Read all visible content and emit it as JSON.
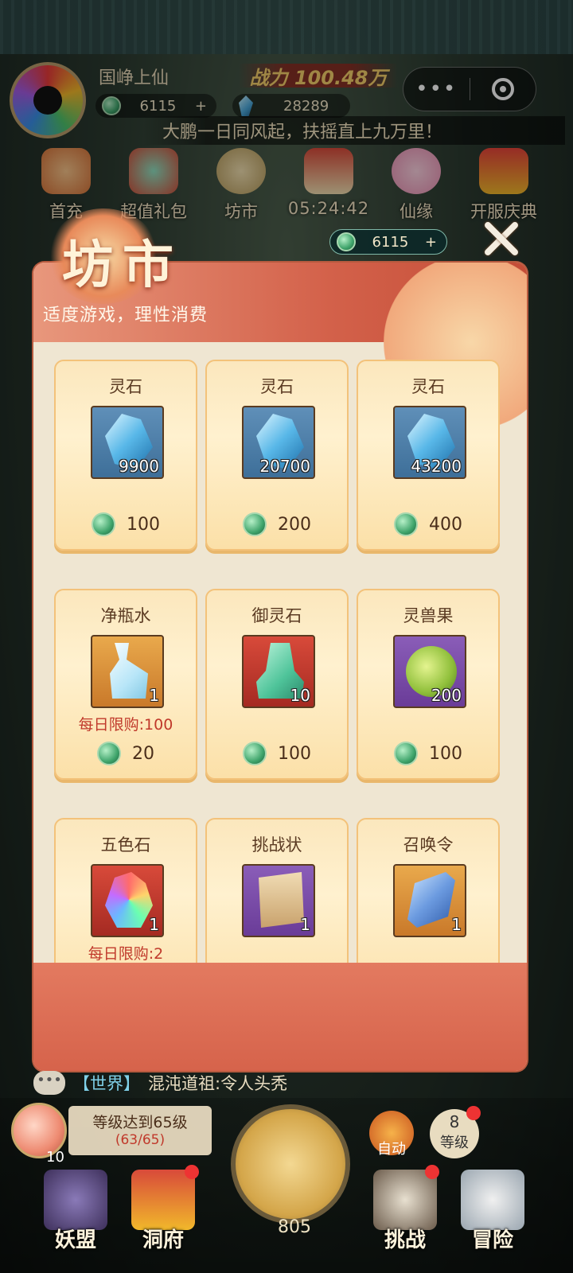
{
  "header": {
    "player_name": "国峥上仙",
    "coins": "6115",
    "coins_add": "+",
    "gems": "28289",
    "power": "战力 100.48万",
    "marquee": "大鹏一日同风起，扶摇直上九万里！"
  },
  "menu": [
    {
      "label": "首充",
      "icon": "gift-bag-icon"
    },
    {
      "label": "超值礼包",
      "icon": "treasure-bag-icon"
    },
    {
      "label": "坊市",
      "icon": "coin-icon"
    },
    {
      "label": "05:24:42",
      "icon": "shop-stall-icon"
    },
    {
      "label": "仙缘",
      "icon": "lotus-icon"
    },
    {
      "label": "开服庆典",
      "icon": "gift-box-icon"
    }
  ],
  "dialog": {
    "title": "坊市",
    "notice": "适度游戏，理性消费",
    "currency": "6115",
    "currency_add": "+"
  },
  "items": [
    {
      "name": "灵石",
      "qty": "9900",
      "price": "100",
      "limit": "",
      "bg": "blue",
      "art": "crystal"
    },
    {
      "name": "灵石",
      "qty": "20700",
      "price": "200",
      "limit": "",
      "bg": "blue",
      "art": "crystal"
    },
    {
      "name": "灵石",
      "qty": "43200",
      "price": "400",
      "limit": "",
      "bg": "blue",
      "art": "crystal"
    },
    {
      "name": "净瓶水",
      "qty": "1",
      "price": "20",
      "limit": "每日限购:100",
      "bg": "gold",
      "art": "vase"
    },
    {
      "name": "御灵石",
      "qty": "10",
      "price": "100",
      "limit": "",
      "bg": "red",
      "art": "jade"
    },
    {
      "name": "灵兽果",
      "qty": "200",
      "price": "100",
      "limit": "",
      "bg": "purple",
      "art": "fruit"
    },
    {
      "name": "五色石",
      "qty": "1",
      "price": "",
      "limit": "每日限购:2",
      "bg": "red",
      "art": "stone"
    },
    {
      "name": "挑战状",
      "qty": "1",
      "price": "",
      "limit": "",
      "bg": "purple",
      "art": "scroll"
    },
    {
      "name": "召唤令",
      "qty": "1",
      "price": "",
      "limit": "",
      "bg": "gold",
      "art": "token"
    }
  ],
  "chat": {
    "icon_text": "•••",
    "channel": "【世界】",
    "message": "混沌道祖:令人头秃"
  },
  "bottom": {
    "peach_count": "10",
    "quest_title": "等级达到65级",
    "quest_progress": "(63/65)",
    "axe_count": "805",
    "auto_label": "自动",
    "level_num": "8",
    "level_label": "等级",
    "nav": [
      "妖盟",
      "洞府",
      "挑战",
      "冒险"
    ]
  },
  "colors": {
    "dialog_bg": "#efe6d2",
    "header_red": "#d3614a",
    "limit_red": "#c0392b"
  }
}
